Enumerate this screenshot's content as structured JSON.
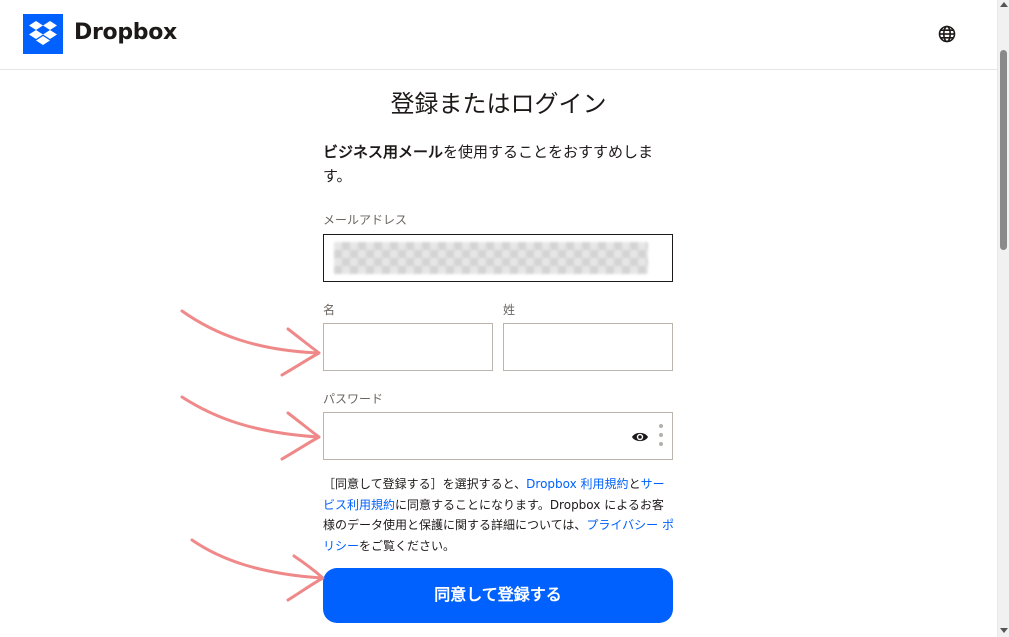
{
  "header": {
    "brand": "Dropbox",
    "logo_icon": "dropbox-logo-icon",
    "language_icon": "globe-icon",
    "brand_color": "#0061fe"
  },
  "page": {
    "title": "登録またはログイン",
    "recommend_bold": "ビジネス用メール",
    "recommend_rest": "を使用することをおすすめします。"
  },
  "form": {
    "email_label": "メールアドレス",
    "first_name_label": "名",
    "last_name_label": "姓",
    "password_label": "パスワード",
    "password_toggle_icon": "eye-icon",
    "submit_label": "同意して登録する"
  },
  "terms": {
    "part1": "［同意して登録する］を選択すると、",
    "link1": "Dropbox 利用規約",
    "part2": "と",
    "link2": "サービス利用規約",
    "part3": "に同意することになります。Dropbox によるお客様のデータ使用と保護に関する詳細については、",
    "link3": "プライバシー ポリシー",
    "part4": "をご覧ください。",
    "link_color": "#0061fe"
  },
  "annotations": {
    "arrow_color": "#ee7d7d",
    "arrow_icon": "hand-drawn-arrow-icon"
  }
}
